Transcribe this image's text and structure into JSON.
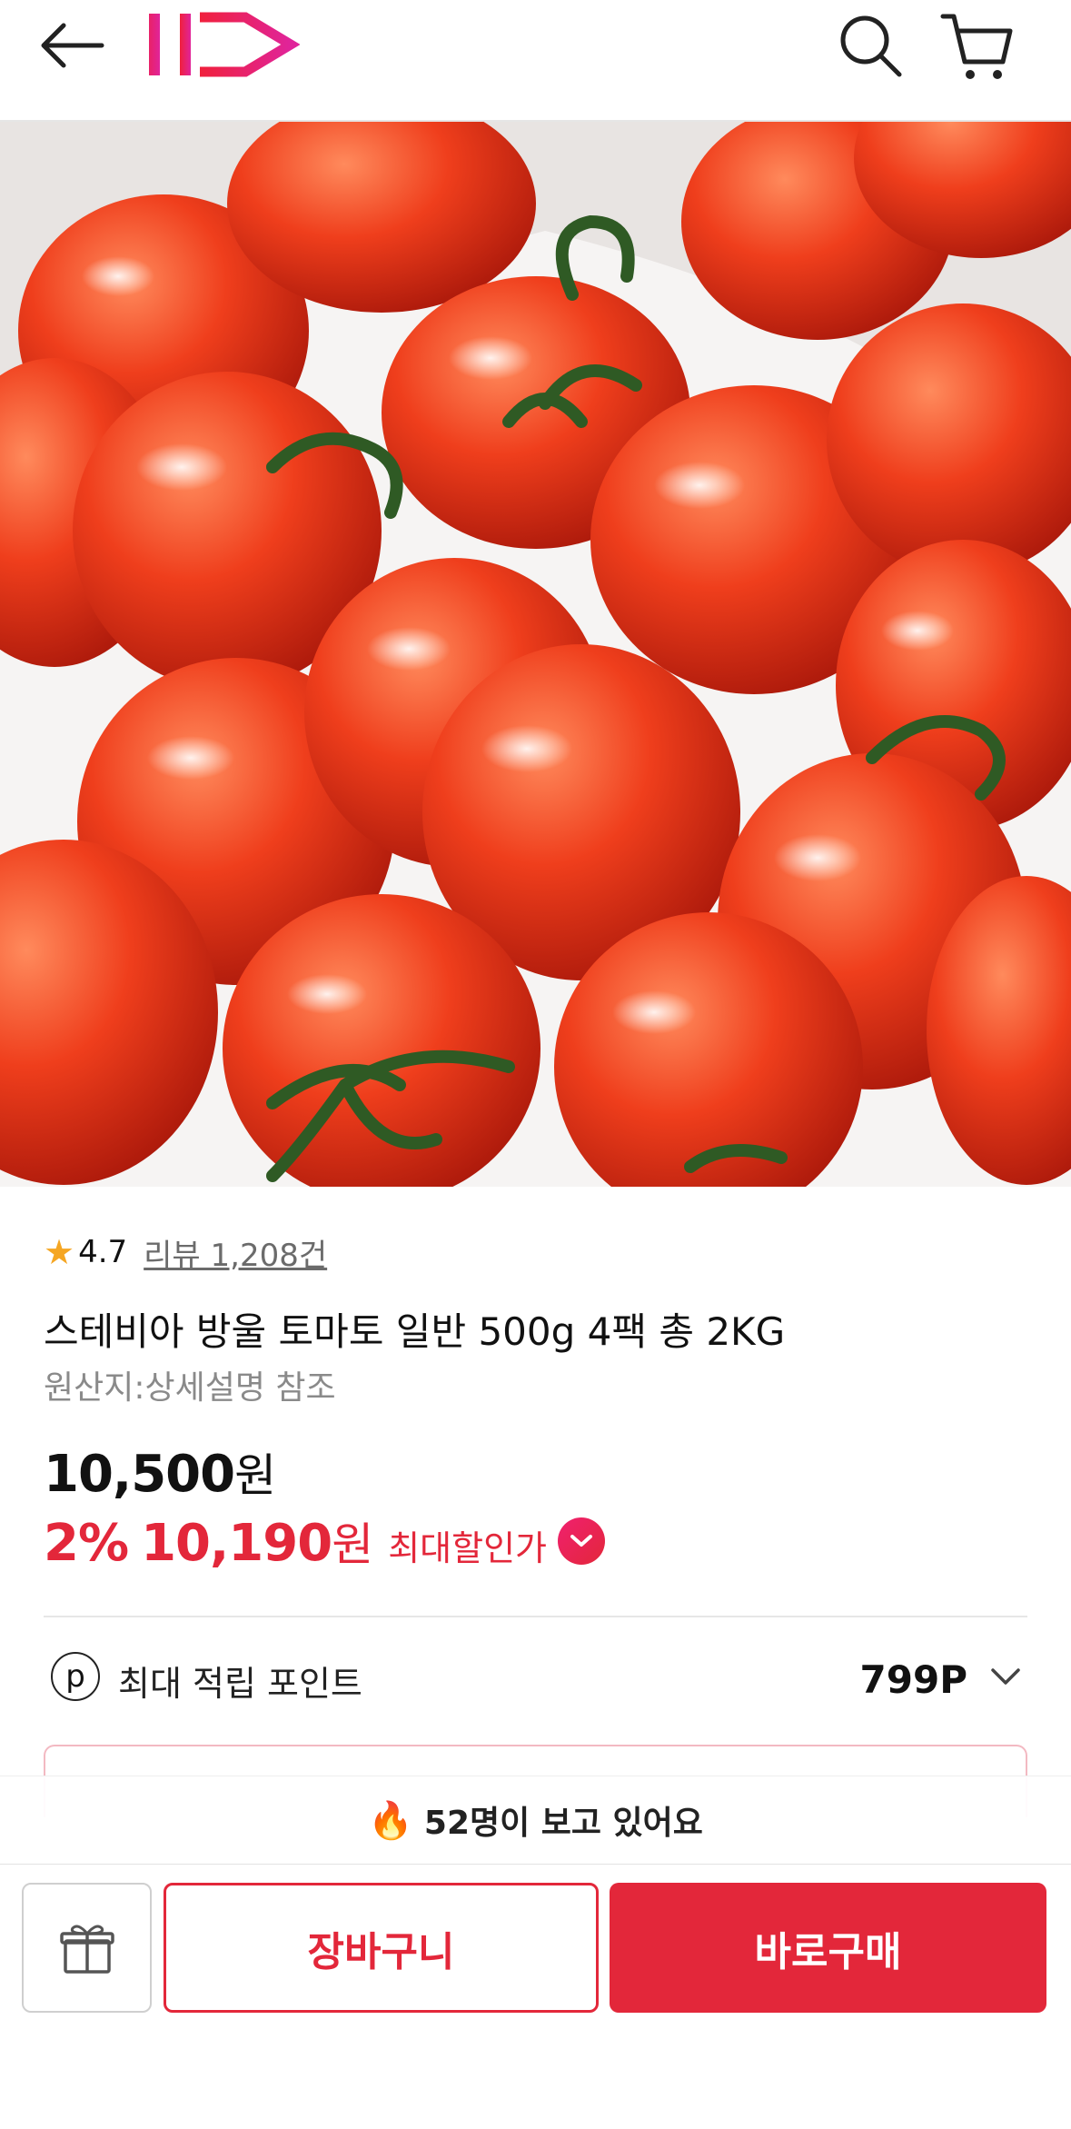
{
  "header": {
    "back_icon": "arrow-left-icon",
    "logo_text": "11",
    "search_icon": "search-icon",
    "cart_icon": "cart-icon"
  },
  "product": {
    "image_alt": "cherry tomatoes",
    "rating": "4.7",
    "review_label": "리뷰 1,208건",
    "title": "스테비아 방울 토마토 일반 500g 4팩 총 2KG",
    "origin": "원산지:상세설명 참조",
    "price": "10,500",
    "price_unit": "원",
    "discount_percent": "2%",
    "discount_price": "10,190",
    "discount_unit": "원",
    "max_discount_label": "최대할인가"
  },
  "points": {
    "label": "최대 적립 포인트",
    "value": "799P",
    "icon": "p"
  },
  "viewers": {
    "emoji": "🔥",
    "text": "52명이 보고 있어요"
  },
  "actions": {
    "gift_icon": "gift-icon",
    "cart_label": "장바구니",
    "buy_label": "바로구매"
  },
  "colors": {
    "brand_red": "#e3273a",
    "brand_pink": "#f0206f",
    "star": "#f5a623"
  }
}
